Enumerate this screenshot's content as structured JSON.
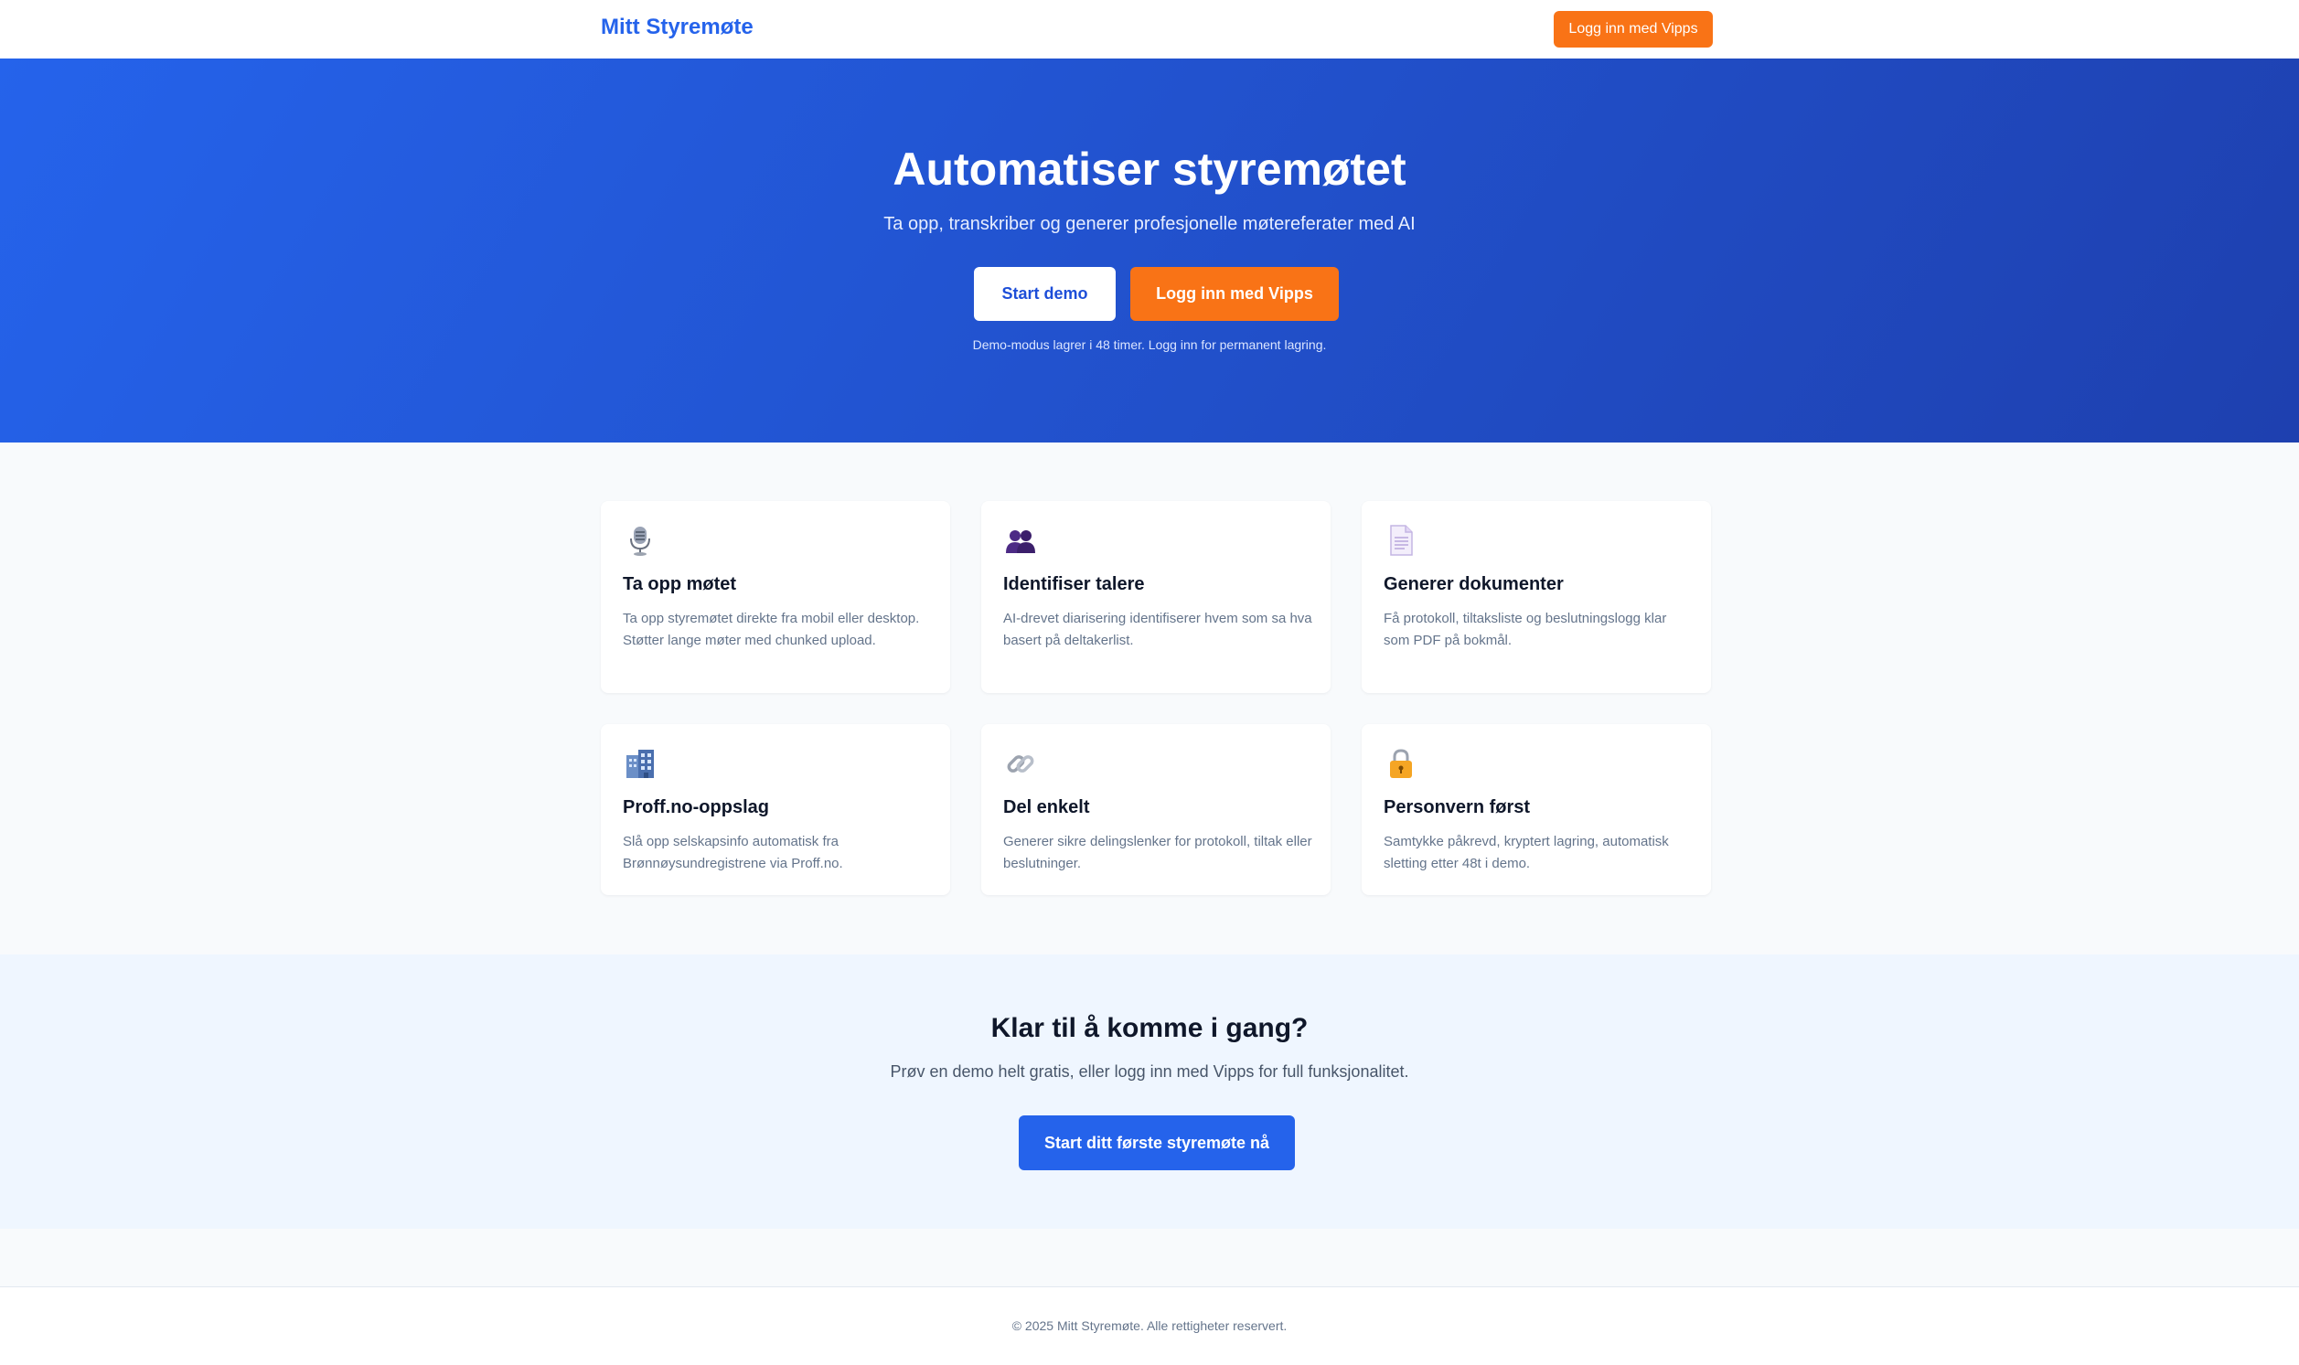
{
  "header": {
    "brand": "Mitt Styremøte",
    "login_label": "Logg inn med Vipps"
  },
  "hero": {
    "title": "Automatiser styremøtet",
    "subtitle": "Ta opp, transkriber og generer profesjonelle møtereferater med AI",
    "demo_button": "Start demo",
    "vipps_button": "Logg inn med Vipps",
    "note": "Demo-modus lagrer i 48 timer. Logg inn for permanent lagring."
  },
  "features": [
    {
      "icon": "microphone-icon",
      "title": "Ta opp møtet",
      "text": "Ta opp styremøtet direkte fra mobil eller desktop. Støtter lange møter med chunked upload."
    },
    {
      "icon": "people-icon",
      "title": "Identifiser talere",
      "text": "AI-drevet diarisering identifiserer hvem som sa hva basert på deltakerlist."
    },
    {
      "icon": "document-icon",
      "title": "Generer dokumenter",
      "text": "Få protokoll, tiltaksliste og beslutningslogg klar som PDF på bokmål."
    },
    {
      "icon": "building-icon",
      "title": "Proff.no-oppslag",
      "text": "Slå opp selskapsinfo automatisk fra Brønnøysundregistrene via Proff.no."
    },
    {
      "icon": "link-icon",
      "title": "Del enkelt",
      "text": "Generer sikre delingslenker for protokoll, tiltak eller beslutninger."
    },
    {
      "icon": "lock-icon",
      "title": "Personvern først",
      "text": "Samtykke påkrevd, kryptert lagring, automatisk sletting etter 48t i demo."
    }
  ],
  "cta": {
    "title": "Klar til å komme i gang?",
    "subtitle": "Prøv en demo helt gratis, eller logg inn med Vipps for full funksjonalitet.",
    "button": "Start ditt første styremøte nå"
  },
  "footer": {
    "copyright": "© 2025 Mitt Styremøte. Alle rettigheter reservert."
  },
  "colors": {
    "primary": "#2563eb",
    "vipps_orange": "#f97316",
    "hero_end": "#1e40af"
  }
}
